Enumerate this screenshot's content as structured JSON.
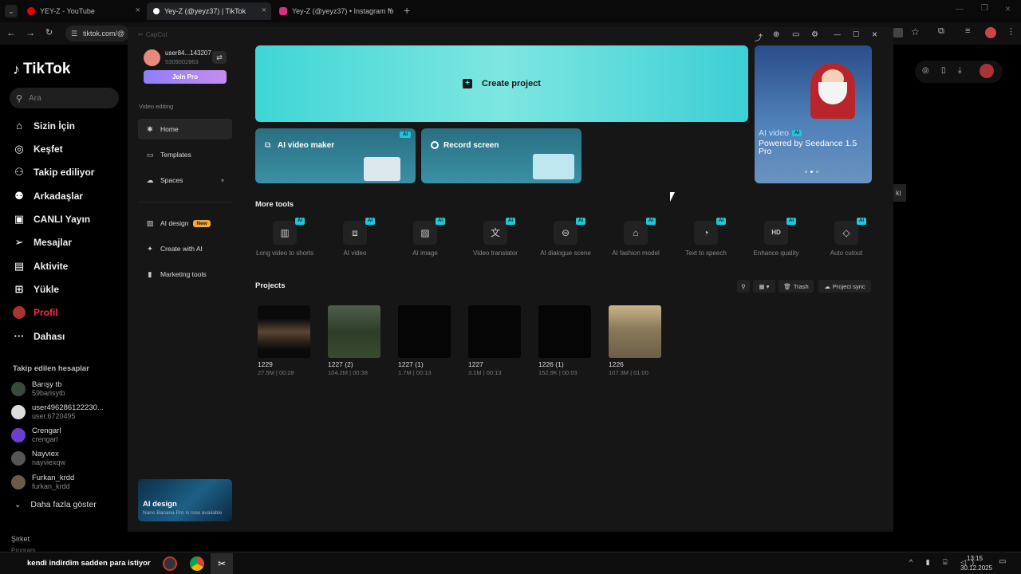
{
  "browser": {
    "tabs": [
      {
        "title": "YEY-Z - YouTube",
        "active": false
      },
      {
        "title": "Yey-Z (@yeyz37) | TikTok",
        "active": true
      },
      {
        "title": "Yey-Z (@yeyz37) • Instagram fo",
        "active": false
      }
    ],
    "url": "tiktok.com/@"
  },
  "tiktok": {
    "logo": "TikTok",
    "search_placeholder": "Ara",
    "nav": [
      {
        "label": "Sizin İçin",
        "icon": "home-icon"
      },
      {
        "label": "Keşfet",
        "icon": "compass-icon"
      },
      {
        "label": "Takip ediliyor",
        "icon": "person-icon"
      },
      {
        "label": "Arkadaşlar",
        "icon": "friends-icon"
      },
      {
        "label": "CANLI Yayın",
        "icon": "live-icon"
      },
      {
        "label": "Mesajlar",
        "icon": "send-icon"
      },
      {
        "label": "Aktivite",
        "icon": "activity-icon"
      },
      {
        "label": "Yükle",
        "icon": "plus-icon"
      },
      {
        "label": "Profil",
        "icon": "avatar-icon"
      },
      {
        "label": "Dahası",
        "icon": "more-icon"
      }
    ],
    "following_title": "Takip edilen hesaplar",
    "following": [
      {
        "name": "Barışy tb",
        "handle": "59barisytb"
      },
      {
        "name": "user496286122230...",
        "handle": "user.6720495"
      },
      {
        "name": "Crengarl",
        "handle": "crengarl"
      },
      {
        "name": "Nayviex",
        "handle": "nayviexqw"
      },
      {
        "name": "Furkan_krdd",
        "handle": "furkan_krdd"
      }
    ],
    "show_more": "Daha fazla göster",
    "footer_1": "Şirket",
    "footer_2": "Program"
  },
  "capcut": {
    "app_name": "CapCut",
    "user": {
      "name": "user84...143207",
      "id": "5309002863"
    },
    "join_pro": "Join Pro",
    "section_label": "Video editing",
    "side_nav": [
      {
        "label": "Home",
        "icon": "home-icon"
      },
      {
        "label": "Templates",
        "icon": "templates-icon"
      },
      {
        "label": "Spaces",
        "icon": "cloud-icon"
      }
    ],
    "side_nav2": [
      {
        "label": "AI design",
        "icon": "ai-design-icon",
        "badge": "New"
      },
      {
        "label": "Create with AI",
        "icon": "sparkle-icon"
      },
      {
        "label": "Marketing tools",
        "icon": "marketing-icon"
      }
    ],
    "promo": {
      "title": "AI design",
      "subtitle": "Nano Banana Pro is now available"
    },
    "create_project": "Create project",
    "ai_video_maker": "AI video maker",
    "record_screen": "Record screen",
    "ai_badge": "AI",
    "banner": {
      "tag": "AI video",
      "title": "Powered by Seedance 1.5 Pro"
    },
    "more_tools_title": "More tools",
    "tools": [
      {
        "name": "Long video to shorts",
        "icon": "film-icon"
      },
      {
        "name": "AI video",
        "icon": "video-icon"
      },
      {
        "name": "AI image",
        "icon": "image-icon"
      },
      {
        "name": "Video translator",
        "icon": "translate-icon"
      },
      {
        "name": "AI dialogue scene",
        "icon": "dialogue-icon"
      },
      {
        "name": "AI fashion model",
        "icon": "shirt-icon"
      },
      {
        "name": "Text to speech",
        "icon": "speech-icon"
      },
      {
        "name": "Enhance quality",
        "icon": "hd-icon"
      },
      {
        "name": "Auto cutout",
        "icon": "eraser-icon"
      }
    ],
    "projects_title": "Projects",
    "trash": "Trash",
    "project_sync": "Project sync",
    "projects": [
      {
        "name": "1229",
        "meta": "27.5M | 00:28",
        "thumb": "#4a3a2a"
      },
      {
        "name": "1227 (2)",
        "meta": "104.2M | 00:38",
        "thumb": "#2f3d2a"
      },
      {
        "name": "1227 (1)",
        "meta": "1.7M | 00:13",
        "thumb": "#050505"
      },
      {
        "name": "1227",
        "meta": "3.1M | 00:13",
        "thumb": "#050505"
      },
      {
        "name": "1226 (1)",
        "meta": "152.9K | 00:03",
        "thumb": "#050505"
      },
      {
        "name": "1226",
        "meta": "107.3M | 01:00",
        "thumb": "#8a7a5a"
      }
    ]
  },
  "taskbar": {
    "ticker": "kendi indirdim sadden para istiyor",
    "time": "13:15",
    "date": "30.12.2025"
  },
  "side_hint": "ki"
}
